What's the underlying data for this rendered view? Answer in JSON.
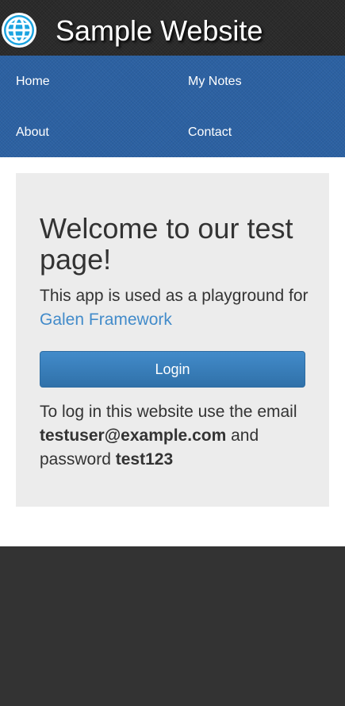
{
  "header": {
    "title": "Sample Website",
    "logo_icon": "globe-icon",
    "background_color": "#2b2b2b"
  },
  "nav": {
    "background_color": "#2c61a2",
    "items": [
      {
        "label": "Home"
      },
      {
        "label": "My Notes"
      },
      {
        "label": "About"
      },
      {
        "label": "Contact"
      }
    ]
  },
  "welcome": {
    "heading": "Welcome to our test page!",
    "intro_text": "This app is used as a playground for",
    "framework_link": "Galen Framework",
    "login_button": "Login",
    "instructions_prefix": "To log in this website use the email",
    "email": "testuser@example.com",
    "password_prefix": "and password",
    "password": "test123",
    "link_color": "#428bca",
    "button_color": "#3071a9"
  },
  "footer": {
    "background_color": "#333333"
  }
}
